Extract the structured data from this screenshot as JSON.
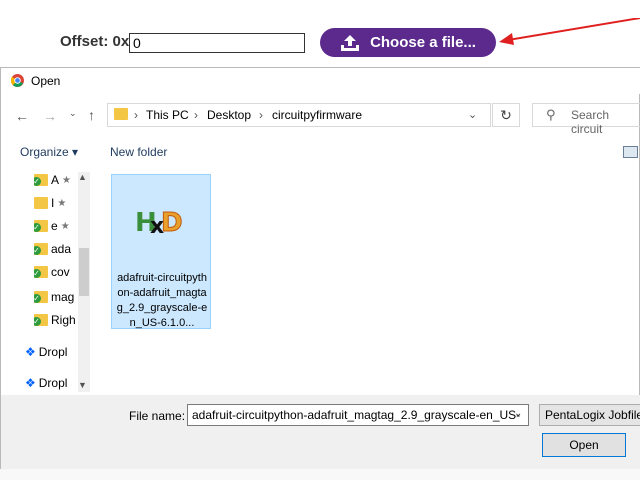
{
  "webpage": {
    "offset_label": "Offset: 0x",
    "offset_value": "0",
    "choose_button_label": "Choose a file..."
  },
  "dialog": {
    "title": "Open",
    "breadcrumb": [
      "This PC",
      "Desktop",
      "circuitpyfirmware"
    ],
    "search_placeholder": "Search circuit",
    "toolbar": {
      "organize_label": "Organize ▾",
      "new_folder_label": "New folder"
    },
    "nav_items": [
      {
        "label": "A",
        "icon": "folder-icon"
      },
      {
        "label": "I",
        "icon": "folder-icon"
      },
      {
        "label": "e",
        "icon": "folder-icon"
      },
      {
        "label": "ada",
        "icon": "folder-icon"
      },
      {
        "label": "cov",
        "icon": "folder-icon"
      },
      {
        "label": "mag",
        "icon": "folder-icon"
      },
      {
        "label": "Righ",
        "icon": "folder-icon"
      },
      {
        "label": "Dropl",
        "icon": "dropbox-icon"
      },
      {
        "label": "Dropl",
        "icon": "dropbox-icon"
      }
    ],
    "file": {
      "name": "adafruit-circuitpython-adafruit_magtag_2.9_grayscale-en_US-6.1.0...",
      "icon": "hxd-icon"
    },
    "file_name_label": "File name:",
    "file_name_value": "adafruit-circuitpython-adafruit_magtag_2.9_grayscale-en_US-",
    "file_type": "PentaLogix Jobfile",
    "open_button_label": "Open"
  },
  "colors": {
    "choose_button": "#5b2a8c",
    "arrow": "#e02020",
    "selection": "#cce8ff"
  }
}
